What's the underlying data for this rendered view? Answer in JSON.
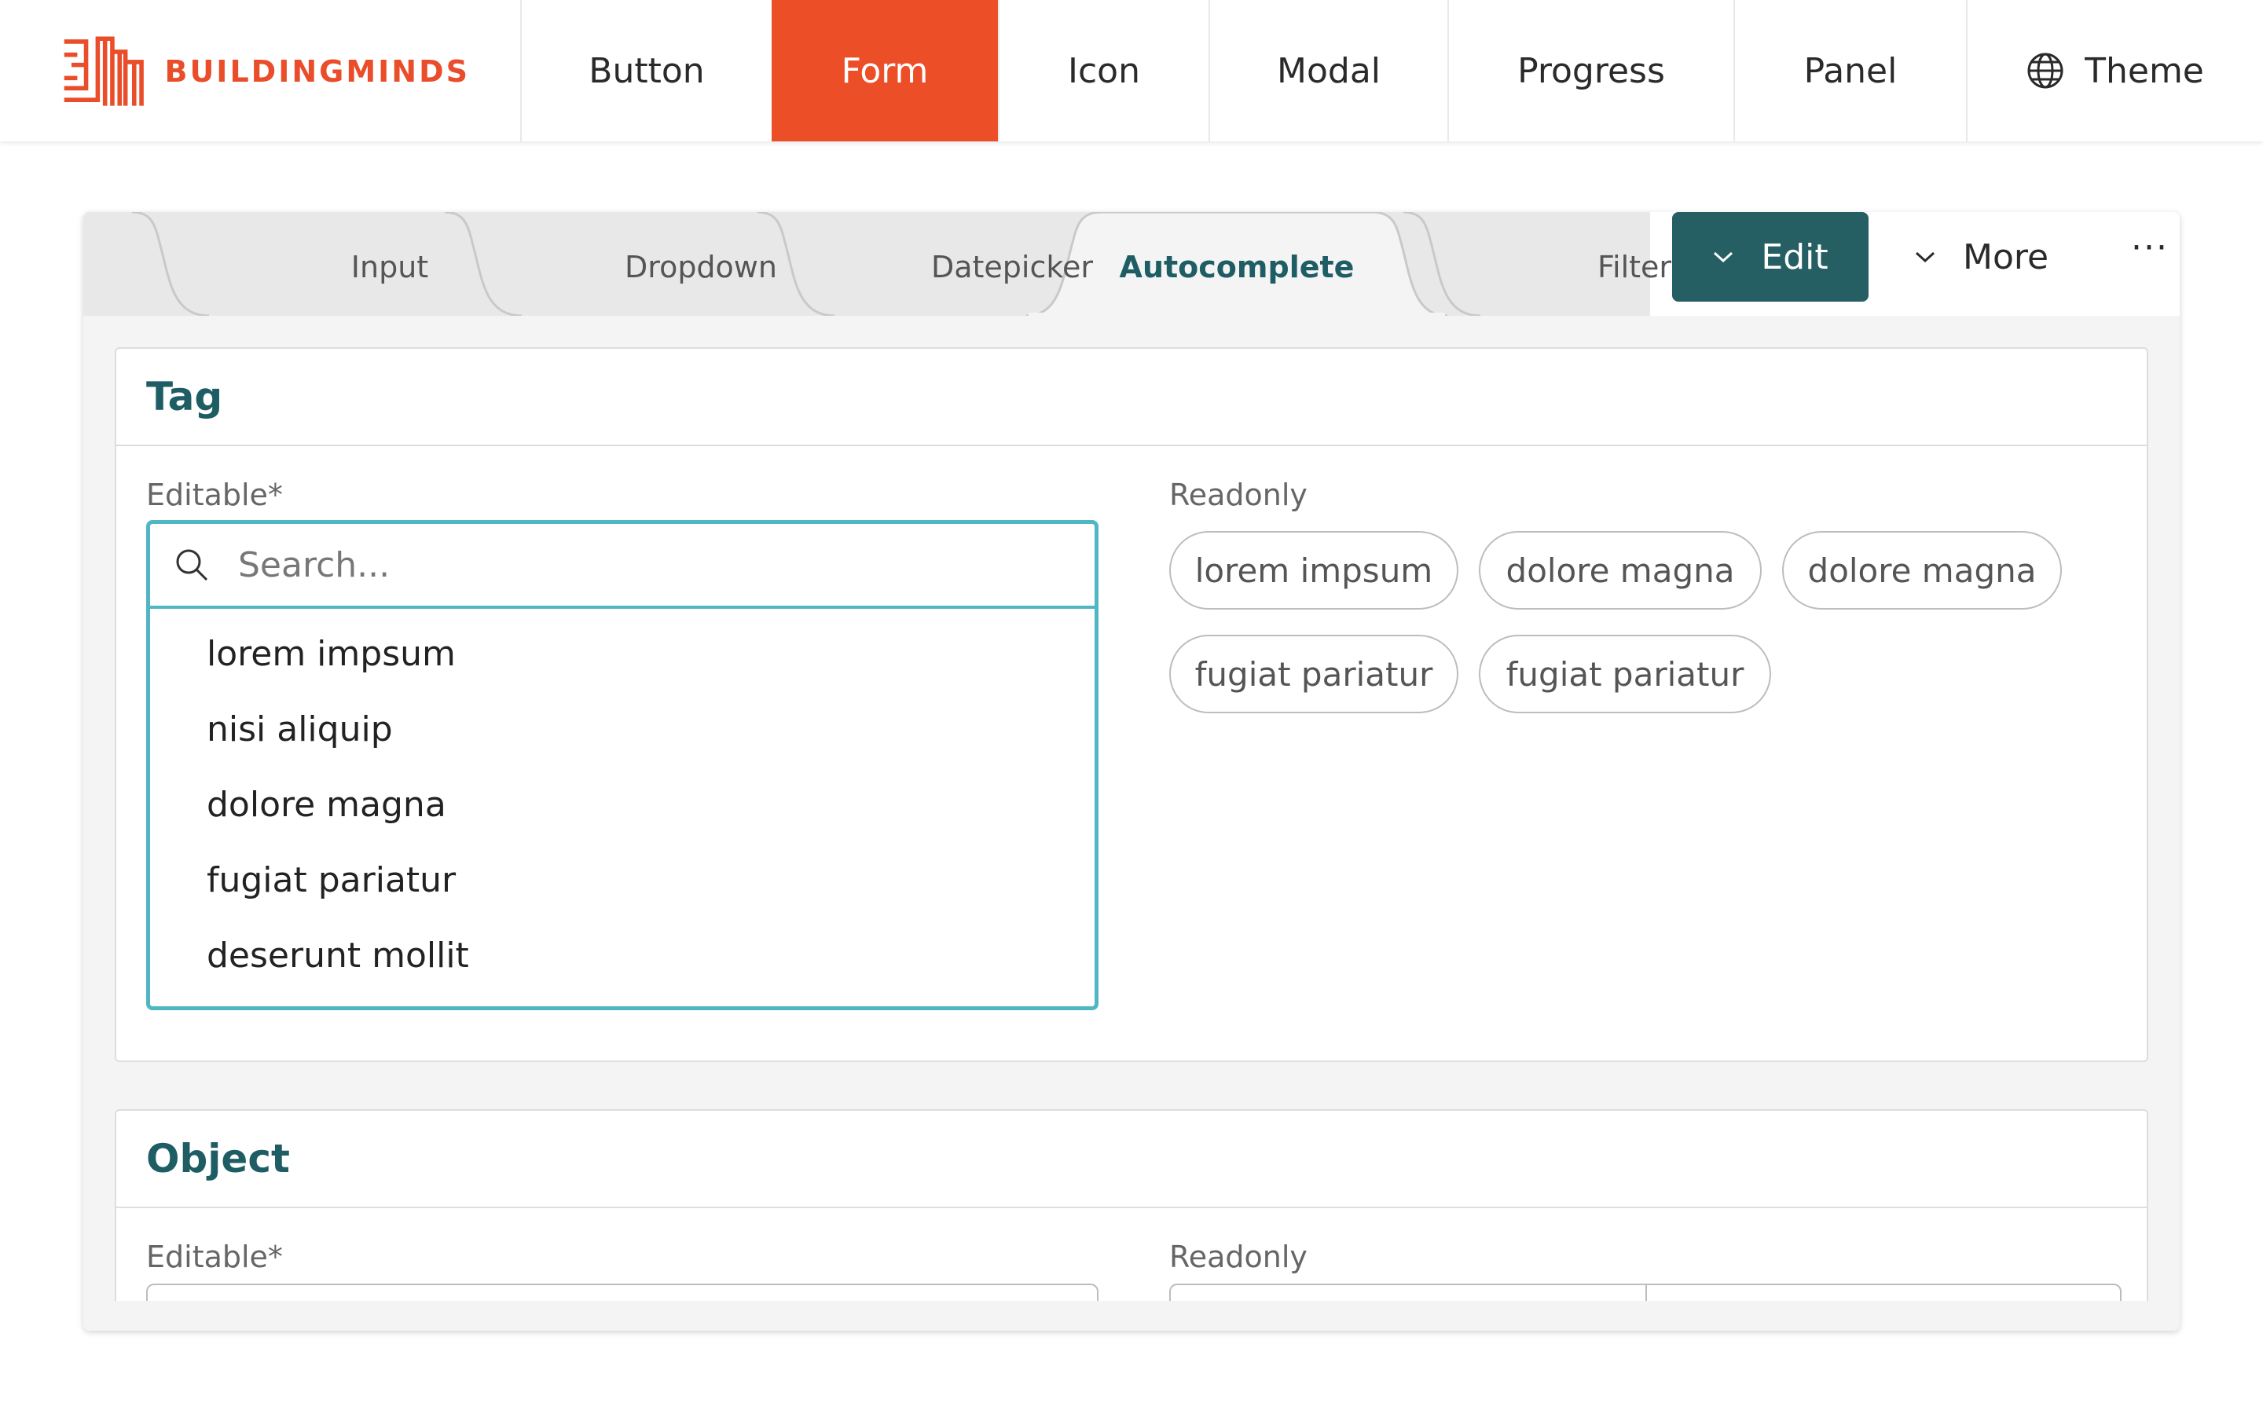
{
  "brand": {
    "name": "BUILDINGMINDS",
    "color": "#ea4d2a"
  },
  "nav": {
    "items": [
      {
        "label": "Button"
      },
      {
        "label": "Form",
        "active": true
      },
      {
        "label": "Icon"
      },
      {
        "label": "Modal"
      },
      {
        "label": "Progress"
      },
      {
        "label": "Panel"
      },
      {
        "label": "Theme",
        "icon": "globe-icon"
      }
    ],
    "active_color": "#ec4e28"
  },
  "tabs": {
    "items": [
      {
        "label": "Input"
      },
      {
        "label": "Dropdown"
      },
      {
        "label": "Datepicker"
      },
      {
        "label": "Autocomplete",
        "active": true
      },
      {
        "label": "Filter"
      }
    ],
    "active_color": "#1d5d63"
  },
  "toolbar": {
    "edit_label": "Edit",
    "edit_color": "#255f63",
    "more_label": "More",
    "overflow_label": "···"
  },
  "tag_section": {
    "title": "Tag",
    "editable_label": "Editable*",
    "readonly_label": "Readonly",
    "search_placeholder": "Search...",
    "options": [
      "lorem impsum",
      "nisi aliquip",
      "dolore magna",
      "fugiat pariatur",
      "deserunt mollit"
    ],
    "chips": [
      "lorem impsum",
      "dolore magna",
      "dolore magna",
      "fugiat pariatur",
      "fugiat pariatur"
    ],
    "focus_color": "#4fb6c2"
  },
  "object_section": {
    "title": "Object",
    "editable_label": "Editable*",
    "readonly_label": "Readonly"
  }
}
